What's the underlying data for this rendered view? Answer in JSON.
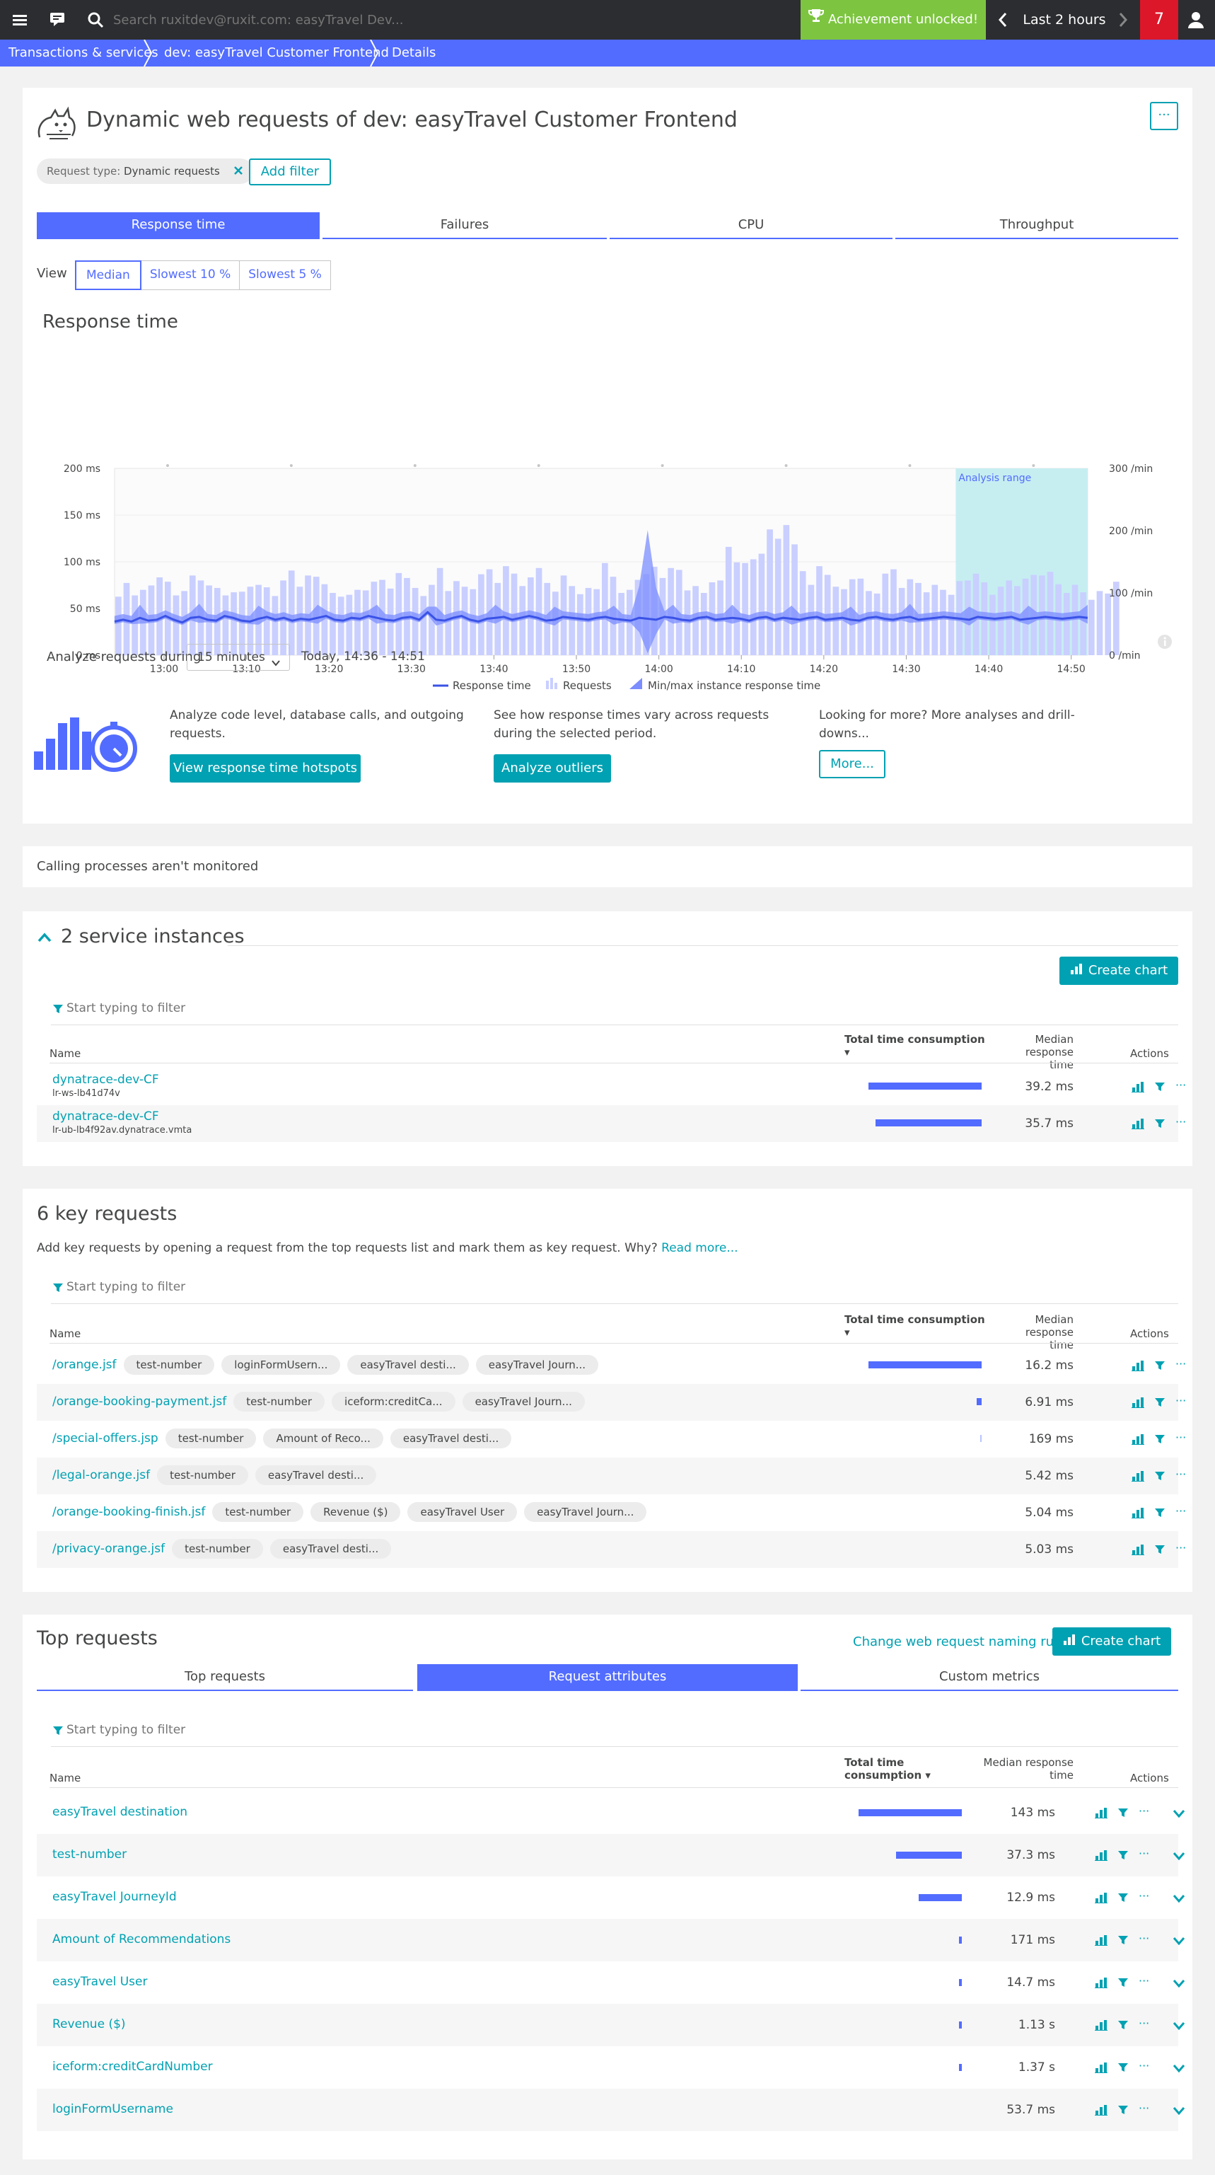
{
  "topbar": {
    "search_placeholder": "Search ruxitdev@ruxit.com: easyTravel Dev...",
    "achievement": "Achievement unlocked!",
    "timeframe": "Last 2 hours",
    "problems": "7"
  },
  "breadcrumbs": [
    "Transactions & services",
    "dev: easyTravel Customer Frontend",
    "Details"
  ],
  "header": {
    "title": "Dynamic web requests of dev: easyTravel Customer Frontend",
    "more": "···",
    "chip_label": "Request type: ",
    "chip_value": "Dynamic requests",
    "add_filter": "Add filter"
  },
  "metric_tabs": [
    "Response time",
    "Failures",
    "CPU",
    "Throughput"
  ],
  "view": {
    "label": "View",
    "options": [
      "Median",
      "Slowest 10 %",
      "Slowest 5 %"
    ]
  },
  "chart_title": "Response time",
  "chart_data": {
    "type": "bar",
    "x": [
      "12:54",
      "12:55",
      "12:56",
      "12:57",
      "12:58",
      "12:59",
      "13:00",
      "13:01",
      "13:02",
      "13:03",
      "13:04",
      "13:05",
      "13:06",
      "13:07",
      "13:08",
      "13:09",
      "13:10",
      "13:11",
      "13:12",
      "13:13",
      "13:14",
      "13:15",
      "13:16",
      "13:17",
      "13:18",
      "13:19",
      "13:20",
      "13:21",
      "13:22",
      "13:23",
      "13:24",
      "13:25",
      "13:26",
      "13:27",
      "13:28",
      "13:29",
      "13:30",
      "13:31",
      "13:32",
      "13:33",
      "13:34",
      "13:35",
      "13:36",
      "13:37",
      "13:38",
      "13:39",
      "13:40",
      "13:41",
      "13:42",
      "13:43",
      "13:44",
      "13:45",
      "13:46",
      "13:47",
      "13:48",
      "13:49",
      "13:50",
      "13:51",
      "13:52",
      "13:53",
      "13:54",
      "13:55",
      "13:56",
      "13:57",
      "13:58",
      "13:59",
      "14:00",
      "14:01",
      "14:02",
      "14:03",
      "14:04",
      "14:05",
      "14:06",
      "14:07",
      "14:08",
      "14:09",
      "14:10",
      "14:11",
      "14:12",
      "14:13",
      "14:14",
      "14:15",
      "14:16",
      "14:17",
      "14:18",
      "14:19",
      "14:20",
      "14:21",
      "14:22",
      "14:23",
      "14:24",
      "14:25",
      "14:26",
      "14:27",
      "14:28",
      "14:29",
      "14:30",
      "14:31",
      "14:32",
      "14:33",
      "14:34",
      "14:35",
      "14:36",
      "14:37",
      "14:38",
      "14:39",
      "14:40",
      "14:41",
      "14:42",
      "14:43",
      "14:44",
      "14:45",
      "14:46",
      "14:47",
      "14:48",
      "14:49",
      "14:50",
      "14:51"
    ],
    "xticks": [
      "13:00",
      "13:10",
      "13:20",
      "13:30",
      "13:40",
      "13:50",
      "14:00",
      "14:10",
      "14:20",
      "14:30",
      "14:40",
      "14:50"
    ],
    "series": [
      {
        "name": "Requests",
        "axis": "right",
        "values": [
          94,
          116,
          96,
          105,
          112,
          125,
          118,
          96,
          103,
          128,
          120,
          112,
          108,
          96,
          101,
          102,
          110,
          113,
          109,
          95,
          120,
          136,
          110,
          128,
          126,
          114,
          100,
          94,
          97,
          105,
          104,
          118,
          121,
          107,
          132,
          124,
          108,
          95,
          113,
          140,
          103,
          119,
          110,
          106,
          130,
          138,
          116,
          143,
          131,
          111,
          125,
          140,
          116,
          102,
          128,
          111,
          98,
          108,
          106,
          148,
          126,
          100,
          105,
          121,
          130,
          142,
          124,
          140,
          137,
          104,
          111,
          100,
          117,
          120,
          174,
          149,
          148,
          154,
          163,
          202,
          187,
          209,
          178,
          135,
          113,
          143,
          129,
          110,
          106,
          122,
          123,
          103,
          99,
          131,
          138,
          108,
          122,
          116,
          101,
          113,
          105,
          97,
          119,
          120,
          131,
          117,
          97,
          110,
          120,
          111,
          123,
          129,
          128,
          134,
          114,
          100,
          113,
          101,
          89,
          103,
          99,
          118
        ]
      },
      {
        "name": "Response time",
        "axis": "left",
        "values": [
          36,
          38,
          36,
          40,
          37,
          38,
          42,
          38,
          35,
          40,
          41,
          38,
          37,
          42,
          40,
          37,
          36,
          39,
          41,
          38,
          40,
          37,
          39,
          38,
          40,
          42,
          38,
          37,
          40,
          39,
          42,
          40,
          38,
          37,
          40,
          41,
          38,
          46,
          38,
          37,
          40,
          42,
          38,
          36,
          39,
          40,
          41,
          38,
          40,
          42,
          40,
          37,
          38,
          41,
          40,
          39,
          38,
          40,
          41,
          39,
          38,
          37,
          40,
          39,
          38,
          41,
          40,
          38,
          37,
          40,
          41,
          38,
          39,
          40,
          39,
          37,
          40,
          41,
          38,
          40,
          39,
          38,
          40,
          41,
          38,
          39,
          40,
          38,
          37,
          40,
          41,
          39,
          38,
          40,
          41,
          38,
          39,
          40,
          41,
          40,
          39,
          38,
          41,
          40,
          39,
          40,
          41,
          38,
          39,
          40,
          41,
          40,
          39,
          40,
          41,
          40
        ]
      },
      {
        "name": "Min/max instance response time",
        "axis": "left"
      }
    ],
    "ylim_left": [
      0,
      200
    ],
    "ylim_right": [
      0,
      300
    ],
    "yticks_left": [
      "200 ms",
      "150 ms",
      "100 ms",
      "50 ms",
      "0 ms"
    ],
    "yticks_right": [
      "300 /min",
      "200 /min",
      "100 /min",
      "0 /min"
    ],
    "highlight_start": "14:36",
    "highlight_end": "14:51",
    "highlight_label": "Analysis range"
  },
  "legend": [
    "Response time",
    "Requests",
    "Min/max instance response time"
  ],
  "analyze": {
    "label": "Analyze requests during",
    "duration": "15 minutes",
    "range": "Today, 14:36 - 14:51",
    "col1_text": "Analyze code level, database calls, and outgoing requests.",
    "col1_button": "View response time hotspots",
    "col2_text": "See how response times vary across requests during the selected period.",
    "col2_button": "Analyze outliers",
    "col3_text": "Looking for more? More analyses and drill-downs...",
    "col3_button": "More..."
  },
  "calling_note": "Calling processes aren't monitored",
  "instances": {
    "title": "2 service instances",
    "create_chart": "Create chart",
    "filter_placeholder": "Start typing to filter",
    "col_name": "Name",
    "col_total": "Total time consumption",
    "col_median": "Median response time",
    "col_actions": "Actions",
    "rows": [
      {
        "name": "dynatrace-dev-CF",
        "host": "lr-ws-lb41d74v",
        "share": 0.92,
        "median": "39.2 ms"
      },
      {
        "name": "dynatrace-dev-CF",
        "host": "lr-ub-lb4f92av.dynatrace.vmta",
        "share": 0.86,
        "median": "35.7 ms"
      }
    ]
  },
  "key_requests": {
    "title": "6 key requests",
    "desc": "Add key requests by opening a request from the top requests list and mark them as key request. Why? ",
    "read_more": "Read more...",
    "filter_placeholder": "Start typing to filter",
    "col_name": "Name",
    "col_total": "Total time consumption",
    "col_median": "Median response time",
    "col_actions": "Actions",
    "rows": [
      {
        "name": "/orange.jsf",
        "tags": [
          "test-number",
          "loginFormUsern...",
          "easyTravel desti...",
          "easyTravel Journ..."
        ],
        "share": 0.92,
        "median": "16.2 ms"
      },
      {
        "name": "/orange-booking-payment.jsf",
        "tags": [
          "test-number",
          "iceform:creditCa...",
          "easyTravel Journ..."
        ],
        "share": 0.04,
        "median": "6.91 ms"
      },
      {
        "name": "/special-offers.jsp",
        "tags": [
          "test-number",
          "Amount of Reco...",
          "easyTravel desti..."
        ],
        "share": 0.01,
        "median": "169 ms"
      },
      {
        "name": "/legal-orange.jsf",
        "tags": [
          "test-number",
          "easyTravel desti..."
        ],
        "share": 0,
        "median": "5.42 ms"
      },
      {
        "name": "/orange-booking-finish.jsf",
        "tags": [
          "test-number",
          "Revenue ($)",
          "easyTravel User",
          "easyTravel Journ..."
        ],
        "share": 0,
        "median": "5.04 ms"
      },
      {
        "name": "/privacy-orange.jsf",
        "tags": [
          "test-number",
          "easyTravel desti..."
        ],
        "share": 0,
        "median": "5.03 ms"
      }
    ]
  },
  "top_requests": {
    "title": "Top requests",
    "naming_link": "Change web request naming rules",
    "create_chart": "Create chart",
    "tabs": [
      "Top requests",
      "Request attributes",
      "Custom metrics"
    ],
    "filter_placeholder": "Start typing to filter",
    "col_name": "Name",
    "col_total": "Total time consumption",
    "col_median": "Median response time",
    "col_actions": "Actions",
    "rows": [
      {
        "name": "easyTravel destination",
        "share": 1.0,
        "median": "143 ms"
      },
      {
        "name": "test-number",
        "share": 0.64,
        "median": "37.3 ms"
      },
      {
        "name": "easyTravel JourneyId",
        "share": 0.42,
        "median": "12.9 ms"
      },
      {
        "name": "Amount of Recommendations",
        "share": 0.03,
        "median": "171 ms"
      },
      {
        "name": "easyTravel User",
        "share": 0.03,
        "median": "14.7 ms"
      },
      {
        "name": "Revenue ($)",
        "share": 0.03,
        "median": "1.13 s"
      },
      {
        "name": "iceform:creditCardNumber",
        "share": 0.03,
        "median": "1.37 s"
      },
      {
        "name": "loginFormUsername",
        "share": 0,
        "median": "53.7 ms"
      }
    ]
  },
  "colors": {
    "accent": "#526cff",
    "teal": "#00a1b2",
    "achievement": "#7dc540",
    "problems": "#dc172a",
    "topbar": "#2c2d30"
  }
}
